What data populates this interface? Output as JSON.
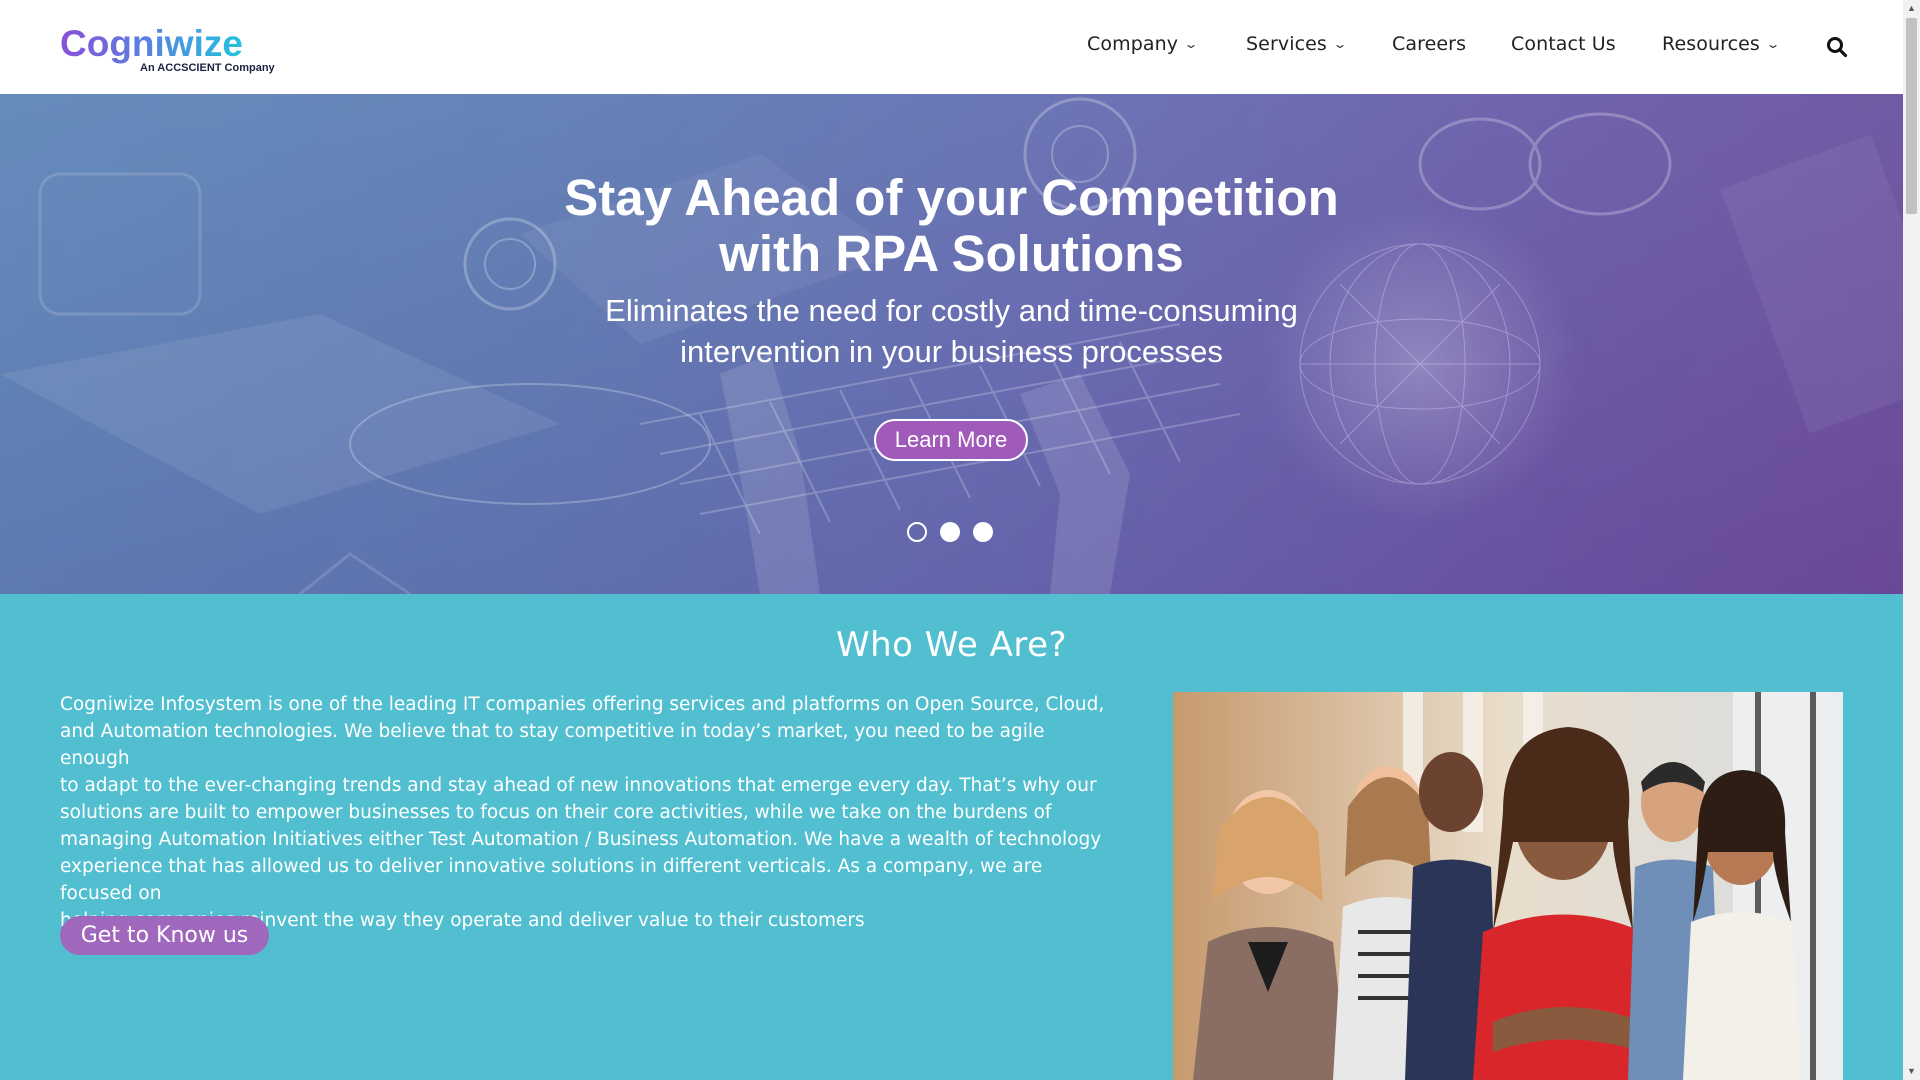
{
  "logo": {
    "name": "Cogniwize",
    "tagline": "An ACCSCIENT Company"
  },
  "nav": {
    "items": [
      {
        "label": "Company",
        "has_dropdown": true
      },
      {
        "label": "Services",
        "has_dropdown": true
      },
      {
        "label": "Careers",
        "has_dropdown": false
      },
      {
        "label": "Contact Us",
        "has_dropdown": false
      },
      {
        "label": "Resources",
        "has_dropdown": true
      }
    ],
    "search_icon": "search-icon",
    "dropdown_icon": "chevron-down-icon"
  },
  "hero": {
    "title_line1": "Stay Ahead of your Competition",
    "title_line2": "with RPA Solutions",
    "subtitle_line1": "Eliminates the need for costly and time-consuming",
    "subtitle_line2": "intervention in your business processes",
    "button_label": "Learn More",
    "slides_total": 3,
    "active_slide": 1
  },
  "about": {
    "heading": "Who We Are?",
    "paragraph_lines": [
      "Cogniwize Infosystem is one of the leading IT companies offering services and platforms on Open Source, Cloud,",
      "and Automation technologies. We believe that to stay competitive in today’s market, you need to be agile enough",
      "to adapt to the ever-changing trends and stay ahead of new innovations that emerge every day. That’s why our",
      "solutions are built to empower businesses to focus on their core activities, while we take on the burdens of",
      "managing Automation Initiatives either Test Automation / Business Automation. We have a wealth of technology",
      "experience that has allowed us to deliver innovative solutions in different verticals. As a company, we are focused on",
      "helping companies reinvent the way they operate and deliver value to their customers"
    ],
    "button_label": "Get to Know us"
  },
  "colors": {
    "brand_purple": "#a05ab9",
    "section_teal": "#52bfd1",
    "button_purple": "#9f68bd",
    "nav_text": "#222222"
  }
}
